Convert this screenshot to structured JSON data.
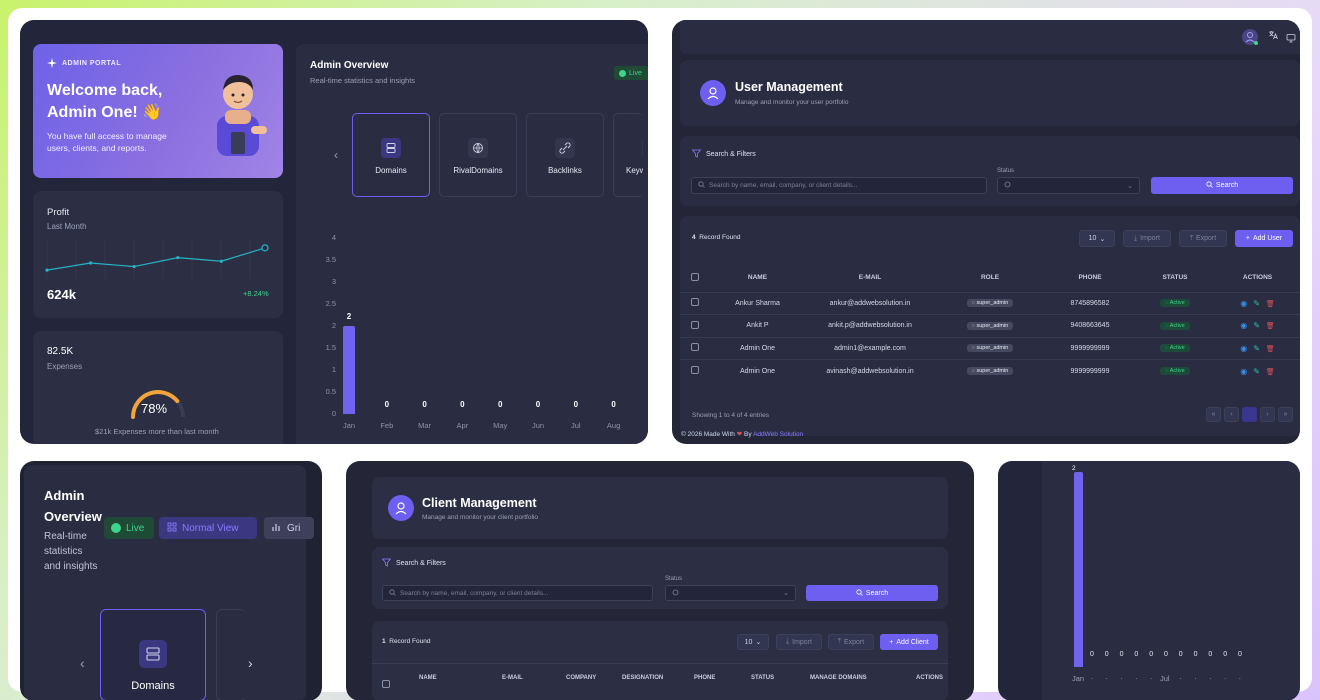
{
  "dashboard": {
    "welcome": {
      "tag": "ADMIN PORTAL",
      "title_line1": "Welcome back,",
      "title_line2": "Admin One! 👋",
      "text": "You have full access to manage users, clients, and reports."
    },
    "profit": {
      "title": "Profit",
      "subtitle": "Last Month",
      "value": "624k",
      "change": "+8.24%",
      "trend": [
        30,
        38,
        34,
        44,
        40,
        55
      ]
    },
    "expenses": {
      "value": "82.5K",
      "label": "Expenses",
      "percent_text": "78%",
      "percent": 78,
      "footnote": "$21k Expenses more than last month"
    },
    "overview": {
      "title": "Admin Overview",
      "subtitle": "Real-time statistics and insights",
      "live_label": "Live",
      "normal_view_label": "Normal View",
      "grid_label": "Gri",
      "tabs": [
        {
          "label": "Domains",
          "icon": "server-icon"
        },
        {
          "label": "RivalDomains",
          "icon": "globe-icon"
        },
        {
          "label": "Backlinks",
          "icon": "link-icon"
        },
        {
          "label": "Keyw",
          "icon": "key-icon"
        }
      ]
    }
  },
  "chart_data": {
    "type": "bar",
    "categories": [
      "Jan",
      "Feb",
      "Mar",
      "Apr",
      "May",
      "Jun",
      "Jul",
      "Aug"
    ],
    "values": [
      2,
      0,
      0,
      0,
      0,
      0,
      0,
      0
    ],
    "yticks": [
      "4",
      "3.5",
      "3",
      "2.5",
      "2",
      "1.5",
      "1",
      "0.5",
      "0"
    ],
    "ylim": [
      0,
      4
    ],
    "bar_color": "#7063f0"
  },
  "users": {
    "title": "User Management",
    "subtitle": "Manage and monitor your user portfolio",
    "filters_label": "Search & Filters",
    "search_placeholder": "Search by name, email, company, or client details...",
    "status_label": "Status",
    "search_button": "Search",
    "record_count": "4",
    "record_label": "Record Found",
    "page_size": "10",
    "import_label": "Import",
    "export_label": "Export",
    "add_label": "Add User",
    "columns": [
      "NAME",
      "E-MAIL",
      "ROLE",
      "PHONE",
      "STATUS",
      "ACTIONS"
    ],
    "rows": [
      {
        "name": "Ankur Sharma",
        "email": "ankur@addwebsolution.in",
        "role": "super_admin",
        "phone": "8745896582",
        "status": "Active"
      },
      {
        "name": "Ankit P",
        "email": "ankit.p@addwebsolution.in",
        "role": "super_admin",
        "phone": "9408663645",
        "status": "Active"
      },
      {
        "name": "Admin One",
        "email": "admin1@example.com",
        "role": "super_admin",
        "phone": "9999999999",
        "status": "Active"
      },
      {
        "name": "Admin One",
        "email": "avinash@addwebsolution.in",
        "role": "super_admin",
        "phone": "9999999999",
        "status": "Active"
      }
    ],
    "showing": "Showing 1 to 4 of 4 entries",
    "footer_prefix": "© 2026 Made With",
    "footer_by": "By",
    "footer_link": "AddWeb Solution"
  },
  "zoom_overview": {
    "title_line1": "Admin",
    "title_line2": "Overview",
    "sub_line1": "Real-time",
    "sub_line2": "statistics",
    "sub_line3": "and insights",
    "live_label": "Live",
    "normal_view_label": "Normal View",
    "grid_label": "Gri",
    "tab_label": "Domains"
  },
  "clients": {
    "title": "Client Management",
    "subtitle": "Manage and monitor your client portfolio",
    "filters_label": "Search & Filters",
    "search_placeholder": "Search by name, email, company, or client details...",
    "status_label": "Status",
    "search_button": "Search",
    "record_count": "1",
    "record_label": "Record Found",
    "page_size": "10",
    "import_label": "Import",
    "export_label": "Export",
    "add_label": "Add Client",
    "columns": [
      "NAME",
      "E-MAIL",
      "COMPANY",
      "DESIGNATION",
      "PHONE",
      "STATUS",
      "MANAGE DOMAINS",
      "ACTIONS"
    ]
  },
  "zoom_chart": {
    "top_value": "2",
    "zero_values": [
      "0",
      "0",
      "0",
      "0",
      "0",
      "0",
      "0",
      "0",
      "0",
      "0",
      "0"
    ],
    "x_labels": [
      "Jan",
      "Jul"
    ]
  },
  "colors": {
    "accent": "#6d5ff0",
    "success": "#3fd48a",
    "danger": "#e0525a",
    "teal": "#26b3c6",
    "orange": "#f2a33a"
  }
}
